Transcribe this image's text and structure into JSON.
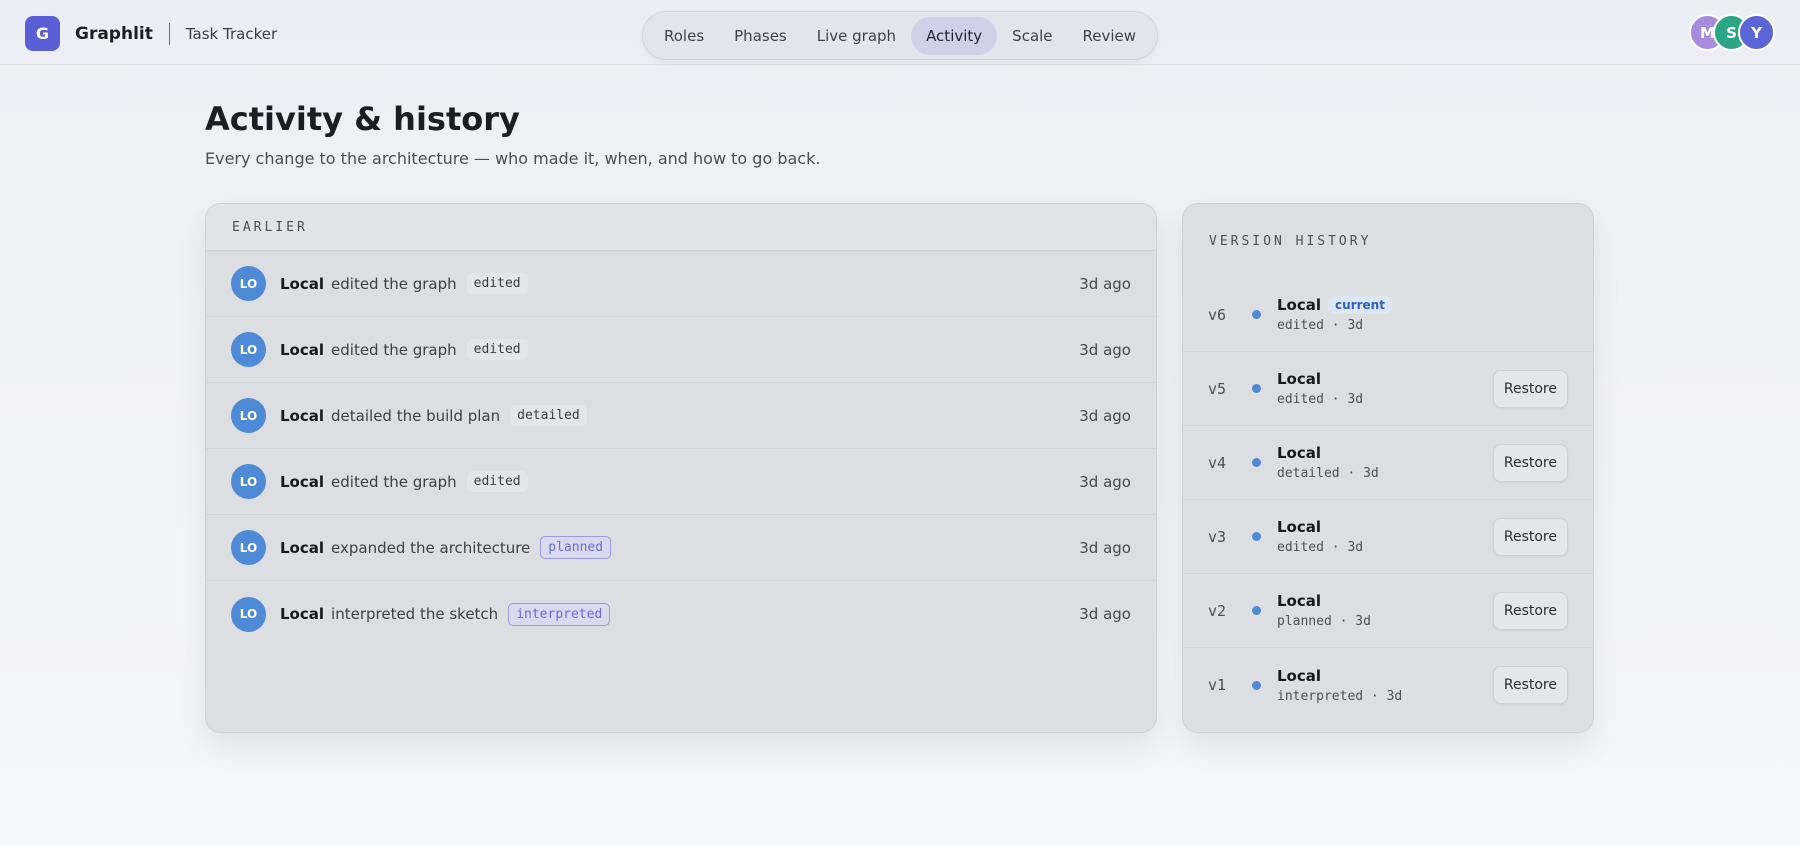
{
  "app": {
    "logo_letter": "G",
    "name": "Graphlit",
    "project": "Task Tracker"
  },
  "nav": {
    "items": [
      {
        "label": "Roles",
        "active": false
      },
      {
        "label": "Phases",
        "active": false
      },
      {
        "label": "Live graph",
        "active": false
      },
      {
        "label": "Activity",
        "active": true
      },
      {
        "label": "Scale",
        "active": false
      },
      {
        "label": "Review",
        "active": false
      }
    ]
  },
  "users": [
    {
      "initial": "M",
      "color": "#a78bdf"
    },
    {
      "initial": "S",
      "color": "#2ca486"
    },
    {
      "initial": "Y",
      "color": "#5b66d6"
    }
  ],
  "page": {
    "title": "Activity & history",
    "subtitle": "Every change to the architecture — who made it, when, and how to go back."
  },
  "activity": {
    "section_label": "EARLIER",
    "rows": [
      {
        "initials": "LO",
        "who": "Local",
        "action": "edited the graph",
        "tag": "edited",
        "tag_style": "plain",
        "when": "3d ago"
      },
      {
        "initials": "LO",
        "who": "Local",
        "action": "edited the graph",
        "tag": "edited",
        "tag_style": "plain",
        "when": "3d ago"
      },
      {
        "initials": "LO",
        "who": "Local",
        "action": "detailed the build plan",
        "tag": "detailed",
        "tag_style": "plain",
        "when": "3d ago"
      },
      {
        "initials": "LO",
        "who": "Local",
        "action": "edited the graph",
        "tag": "edited",
        "tag_style": "plain",
        "when": "3d ago"
      },
      {
        "initials": "LO",
        "who": "Local",
        "action": "expanded the architecture",
        "tag": "planned",
        "tag_style": "violet",
        "when": "3d ago"
      },
      {
        "initials": "LO",
        "who": "Local",
        "action": "interpreted the sketch",
        "tag": "interpreted",
        "tag_style": "violet",
        "when": "3d ago"
      }
    ]
  },
  "versions": {
    "section_label": "VERSION HISTORY",
    "current_label": "current",
    "restore_label": "Restore",
    "rows": [
      {
        "version": "v6",
        "who": "Local",
        "meta": "edited · 3d",
        "current": true
      },
      {
        "version": "v5",
        "who": "Local",
        "meta": "edited · 3d",
        "current": false
      },
      {
        "version": "v4",
        "who": "Local",
        "meta": "detailed · 3d",
        "current": false
      },
      {
        "version": "v3",
        "who": "Local",
        "meta": "edited · 3d",
        "current": false
      },
      {
        "version": "v2",
        "who": "Local",
        "meta": "planned · 3d",
        "current": false
      },
      {
        "version": "v1",
        "who": "Local",
        "meta": "interpreted · 3d",
        "current": false
      }
    ]
  },
  "colors": {
    "brand": "#5a5fd6",
    "avatar_local": "#4f8ad6",
    "nav_active": "#cfd1e8"
  }
}
